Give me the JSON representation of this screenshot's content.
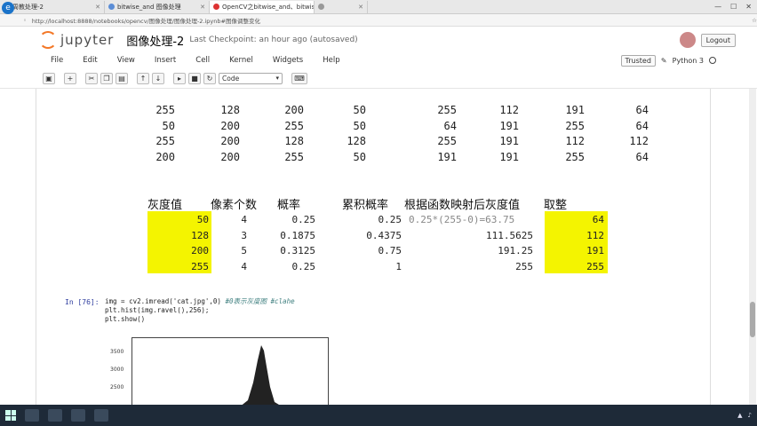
{
  "browser": {
    "tabs": [
      {
        "label": "周教处理-2",
        "active": false
      },
      {
        "label": "bitwise_and 图像处理",
        "active": false
      },
      {
        "label": "OpenCV之bitwise_and、bitwis",
        "active": true
      },
      {
        "label": "",
        "active": false
      }
    ],
    "url": "http://localhost:8888/notebooks/opencv/图像处理/图像处理-2.ipynb#图像调整变化",
    "win_min": "—",
    "win_max": "☐",
    "win_close": "✕"
  },
  "header": {
    "logo_text": "jupyter",
    "notebook_title": "图像处理-2",
    "checkpoint": "Last Checkpoint: an hour ago (autosaved)",
    "logout": "Logout"
  },
  "menu": {
    "items": [
      "File",
      "Edit",
      "View",
      "Insert",
      "Cell",
      "Kernel",
      "Widgets",
      "Help"
    ],
    "trusted": "Trusted",
    "kernel": "Python 3"
  },
  "toolbar": {
    "cell_type": "Code"
  },
  "pixel_matrix": {
    "left": [
      [
        "255",
        "128",
        "200",
        "50"
      ],
      [
        "50",
        "200",
        "255",
        "50"
      ],
      [
        "255",
        "200",
        "128",
        "128"
      ],
      [
        "200",
        "200",
        "255",
        "50"
      ]
    ],
    "right": [
      [
        "255",
        "112",
        "191",
        "64"
      ],
      [
        "64",
        "191",
        "255",
        "64"
      ],
      [
        "255",
        "191",
        "112",
        "112"
      ],
      [
        "191",
        "191",
        "255",
        "64"
      ]
    ]
  },
  "mapping_table": {
    "headers": [
      "灰度值",
      "像素个数",
      "概率",
      "累积概率",
      "根据函数映射后灰度值",
      "取整"
    ],
    "formula_note": "0.25*(255-0)=63.75",
    "rows": [
      [
        "50",
        "4",
        "0.25",
        "0.25",
        "",
        "64"
      ],
      [
        "128",
        "3",
        "0.1875",
        "0.4375",
        "111.5625",
        "112"
      ],
      [
        "200",
        "5",
        "0.3125",
        "0.75",
        "191.25",
        "191"
      ],
      [
        "255",
        "4",
        "0.25",
        "1",
        "255",
        "255"
      ]
    ],
    "highlight_color": "#f4f400"
  },
  "code_cell": {
    "prompt": "In [76]:",
    "lines": [
      "img = cv2.imread('cat.jpg',0) ",
      "plt.hist(img.ravel(),256);",
      "plt.show()"
    ],
    "comment": "#0表示灰度图 #clahe"
  },
  "plot": {
    "yticks": [
      "3500",
      "3000",
      "2500"
    ]
  },
  "chart_data": {
    "type": "bar",
    "title": "",
    "xlabel": "",
    "ylabel": "",
    "visible_yticks": [
      3500,
      3000,
      2500
    ],
    "note": "histogram of grayscale image, single narrow peak near center; partially visible"
  }
}
